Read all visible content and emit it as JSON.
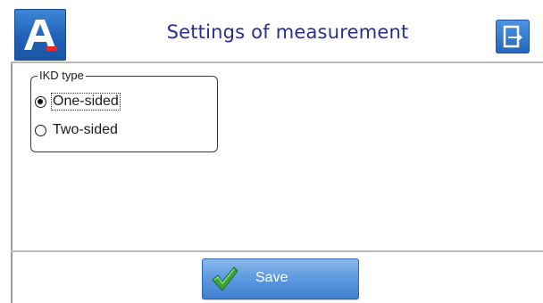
{
  "header": {
    "title": "Settings of measurement",
    "logo_letter": "A",
    "logo_icon": "app-logo-icon",
    "exit_icon": "exit-icon"
  },
  "ikd_type": {
    "legend": "IKD type",
    "options": [
      {
        "label": "One-sided",
        "selected": true
      },
      {
        "label": "Two-sided",
        "selected": false
      }
    ]
  },
  "footer": {
    "save_label": "Save",
    "save_icon": "checkmark-icon"
  },
  "colors": {
    "title_text": "#2a2f8f",
    "accent_blue": "#2466bd",
    "check_green": "#3aa33a",
    "logo_red": "#e52a2a"
  }
}
